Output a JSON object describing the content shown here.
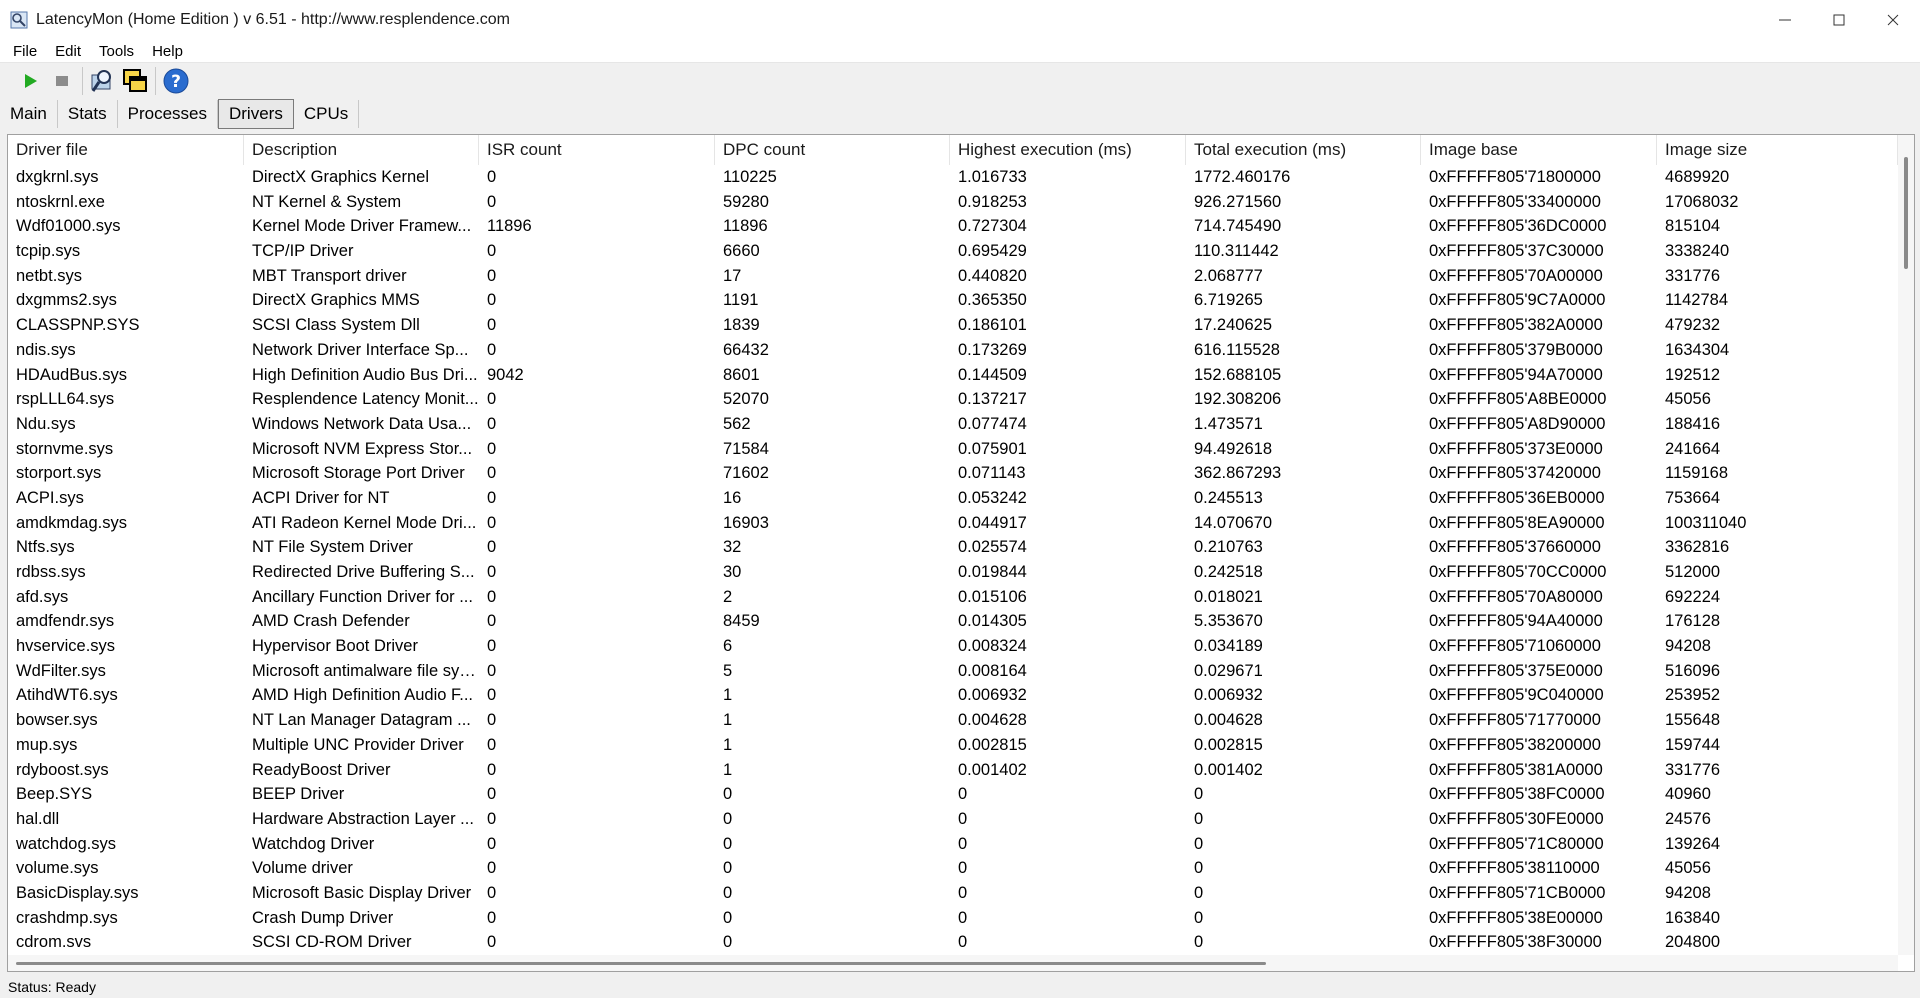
{
  "window": {
    "title": "LatencyMon  (Home Edition )  v 6.51 - http://www.resplendence.com",
    "app_icon": "magnifier-app-icon",
    "controls": [
      "minimize-icon",
      "maximize-icon",
      "close-icon"
    ]
  },
  "menu": {
    "file": "File",
    "edit": "Edit",
    "tools": "Tools",
    "help": "Help"
  },
  "toolbar": {
    "icons": [
      "play-icon",
      "stop-icon",
      "search-window-icon",
      "windows-overlap-icon",
      "help-icon"
    ],
    "play_color": "#22aa22",
    "help_color": "#2a6ccf"
  },
  "tabs": [
    {
      "label": "Main"
    },
    {
      "label": "Stats"
    },
    {
      "label": "Processes"
    },
    {
      "label": "Drivers",
      "active": true
    },
    {
      "label": "CPUs"
    }
  ],
  "table": {
    "columns": [
      "Driver file",
      "Description",
      "ISR count",
      "DPC count",
      "Highest execution (ms)",
      "Total execution (ms)",
      "Image base",
      "Image size"
    ],
    "rows": [
      [
        "dxgkrnl.sys",
        "DirectX Graphics Kernel",
        "0",
        "110225",
        "1.016733",
        "1772.460176",
        "0xFFFFF805'71800000",
        "4689920"
      ],
      [
        "ntoskrnl.exe",
        "NT Kernel & System",
        "0",
        "59280",
        "0.918253",
        "926.271560",
        "0xFFFFF805'33400000",
        "17068032"
      ],
      [
        "Wdf01000.sys",
        "Kernel Mode Driver Framew...",
        "11896",
        "11896",
        "0.727304",
        "714.745490",
        "0xFFFFF805'36DC0000",
        "815104"
      ],
      [
        "tcpip.sys",
        "TCP/IP Driver",
        "0",
        "6660",
        "0.695429",
        "110.311442",
        "0xFFFFF805'37C30000",
        "3338240"
      ],
      [
        "netbt.sys",
        "MBT Transport driver",
        "0",
        "17",
        "0.440820",
        "2.068777",
        "0xFFFFF805'70A00000",
        "331776"
      ],
      [
        "dxgmms2.sys",
        "DirectX Graphics MMS",
        "0",
        "1191",
        "0.365350",
        "6.719265",
        "0xFFFFF805'9C7A0000",
        "1142784"
      ],
      [
        "CLASSPNP.SYS",
        "SCSI Class System Dll",
        "0",
        "1839",
        "0.186101",
        "17.240625",
        "0xFFFFF805'382A0000",
        "479232"
      ],
      [
        "ndis.sys",
        "Network Driver Interface Sp...",
        "0",
        "66432",
        "0.173269",
        "616.115528",
        "0xFFFFF805'379B0000",
        "1634304"
      ],
      [
        "HDAudBus.sys",
        "High Definition Audio Bus Dri...",
        "9042",
        "8601",
        "0.144509",
        "152.688105",
        "0xFFFFF805'94A70000",
        "192512"
      ],
      [
        "rspLLL64.sys",
        "Resplendence Latency Monit...",
        "0",
        "52070",
        "0.137217",
        "192.308206",
        "0xFFFFF805'A8BE0000",
        "45056"
      ],
      [
        "Ndu.sys",
        "Windows Network Data Usa...",
        "0",
        "562",
        "0.077474",
        "1.473571",
        "0xFFFFF805'A8D90000",
        "188416"
      ],
      [
        "stornvme.sys",
        "Microsoft NVM Express Stor...",
        "0",
        "71584",
        "0.075901",
        "94.492618",
        "0xFFFFF805'373E0000",
        "241664"
      ],
      [
        "storport.sys",
        "Microsoft Storage Port Driver",
        "0",
        "71602",
        "0.071143",
        "362.867293",
        "0xFFFFF805'37420000",
        "1159168"
      ],
      [
        "ACPI.sys",
        "ACPI Driver for NT",
        "0",
        "16",
        "0.053242",
        "0.245513",
        "0xFFFFF805'36EB0000",
        "753664"
      ],
      [
        "amdkmdag.sys",
        "ATI Radeon Kernel Mode Dri...",
        "0",
        "16903",
        "0.044917",
        "14.070670",
        "0xFFFFF805'8EA90000",
        "100311040"
      ],
      [
        "Ntfs.sys",
        "NT File System Driver",
        "0",
        "32",
        "0.025574",
        "0.210763",
        "0xFFFFF805'37660000",
        "3362816"
      ],
      [
        "rdbss.sys",
        "Redirected Drive Buffering S...",
        "0",
        "30",
        "0.019844",
        "0.242518",
        "0xFFFFF805'70CC0000",
        "512000"
      ],
      [
        "afd.sys",
        "Ancillary Function Driver for ...",
        "0",
        "2",
        "0.015106",
        "0.018021",
        "0xFFFFF805'70A80000",
        "692224"
      ],
      [
        "amdfendr.sys",
        "AMD Crash Defender",
        "0",
        "8459",
        "0.014305",
        "5.353670",
        "0xFFFFF805'94A40000",
        "176128"
      ],
      [
        "hvservice.sys",
        "Hypervisor Boot Driver",
        "0",
        "6",
        "0.008324",
        "0.034189",
        "0xFFFFF805'71060000",
        "94208"
      ],
      [
        "WdFilter.sys",
        "Microsoft antimalware file sys...",
        "0",
        "5",
        "0.008164",
        "0.029671",
        "0xFFFFF805'375E0000",
        "516096"
      ],
      [
        "AtihdWT6.sys",
        "AMD High Definition Audio F...",
        "0",
        "1",
        "0.006932",
        "0.006932",
        "0xFFFFF805'9C040000",
        "253952"
      ],
      [
        "bowser.sys",
        "NT Lan Manager Datagram ...",
        "0",
        "1",
        "0.004628",
        "0.004628",
        "0xFFFFF805'71770000",
        "155648"
      ],
      [
        "mup.sys",
        "Multiple UNC Provider Driver",
        "0",
        "1",
        "0.002815",
        "0.002815",
        "0xFFFFF805'38200000",
        "159744"
      ],
      [
        "rdyboost.sys",
        "ReadyBoost Driver",
        "0",
        "1",
        "0.001402",
        "0.001402",
        "0xFFFFF805'381A0000",
        "331776"
      ],
      [
        "Beep.SYS",
        "BEEP Driver",
        "0",
        "0",
        "0",
        "0",
        "0xFFFFF805'38FC0000",
        "40960"
      ],
      [
        "hal.dll",
        "Hardware Abstraction Layer ...",
        "0",
        "0",
        "0",
        "0",
        "0xFFFFF805'30FE0000",
        "24576"
      ],
      [
        "watchdog.sys",
        "Watchdog Driver",
        "0",
        "0",
        "0",
        "0",
        "0xFFFFF805'71C80000",
        "139264"
      ],
      [
        "volume.sys",
        "Volume driver",
        "0",
        "0",
        "0",
        "0",
        "0xFFFFF805'38110000",
        "45056"
      ],
      [
        "BasicDisplay.sys",
        "Microsoft Basic Display Driver",
        "0",
        "0",
        "0",
        "0",
        "0xFFFFF805'71CB0000",
        "94208"
      ],
      [
        "crashdmp.sys",
        "Crash Dump Driver",
        "0",
        "0",
        "0",
        "0",
        "0xFFFFF805'38E00000",
        "163840"
      ],
      [
        "cdrom.svs",
        "SCSI CD-ROM Driver",
        "0",
        "0",
        "0",
        "0",
        "0xFFFFF805'38F30000",
        "204800"
      ]
    ]
  },
  "status": {
    "text": "Status: Ready"
  }
}
